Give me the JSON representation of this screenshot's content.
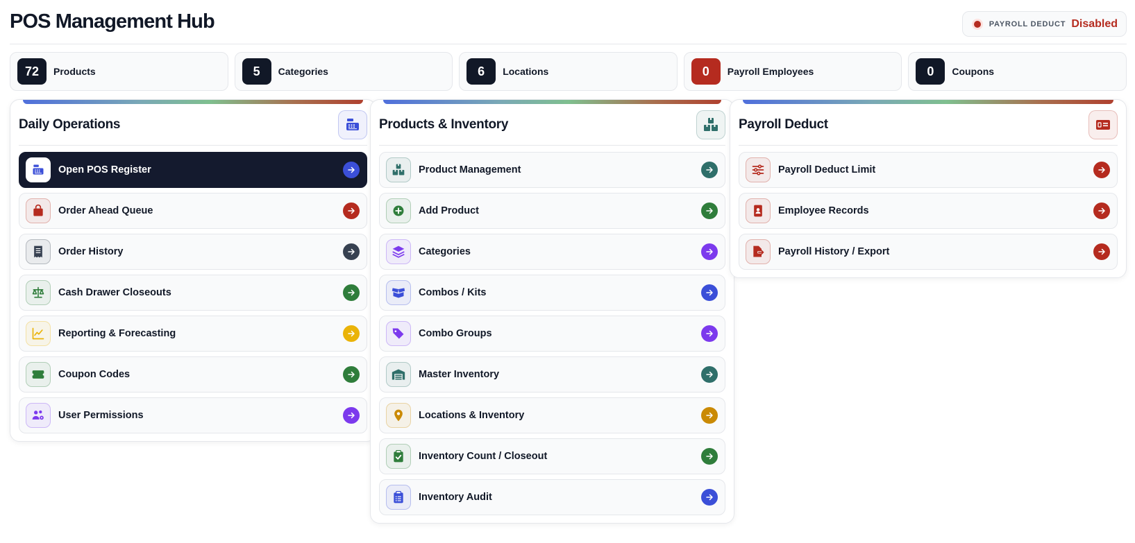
{
  "header": {
    "title": "POS Management Hub",
    "status_label": "PAYROLL DEDUCT",
    "status_value": "Disabled",
    "status_color": "#b52b1f"
  },
  "stats": [
    {
      "count": "72",
      "label": "Products",
      "color": "#111827"
    },
    {
      "count": "5",
      "label": "Categories",
      "color": "#111827"
    },
    {
      "count": "6",
      "label": "Locations",
      "color": "#111827"
    },
    {
      "count": "0",
      "label": "Payroll Employees",
      "color": "#b52b1f"
    },
    {
      "count": "0",
      "label": "Coupons",
      "color": "#111827"
    }
  ],
  "panels": [
    {
      "title": "Daily Operations",
      "icon": "cash-register-icon",
      "items": [
        {
          "label": "Open POS Register",
          "icon": "cash-register-icon",
          "color": "#3b4fd8",
          "active": true
        },
        {
          "label": "Order Ahead Queue",
          "icon": "shopping-bag-icon",
          "color": "#b52b1f"
        },
        {
          "label": "Order History",
          "icon": "receipt-icon",
          "color": "#374151"
        },
        {
          "label": "Cash Drawer Closeouts",
          "icon": "scale-icon",
          "color": "#2f7d3b"
        },
        {
          "label": "Reporting & Forecasting",
          "icon": "chart-line-icon",
          "color": "#eab308"
        },
        {
          "label": "Coupon Codes",
          "icon": "ticket-icon",
          "color": "#2f7d3b"
        },
        {
          "label": "User Permissions",
          "icon": "users-gear-icon",
          "color": "#7c3aed"
        }
      ]
    },
    {
      "title": "Products & Inventory",
      "icon": "boxes-icon",
      "items": [
        {
          "label": "Product Management",
          "icon": "boxes-icon",
          "color": "#2f6f6a"
        },
        {
          "label": "Add Product",
          "icon": "plus-circle-icon",
          "color": "#2f7d3b"
        },
        {
          "label": "Categories",
          "icon": "layers-icon",
          "color": "#7c3aed"
        },
        {
          "label": "Combos / Kits",
          "icon": "box-open-icon",
          "color": "#3b4fd8"
        },
        {
          "label": "Combo Groups",
          "icon": "tags-icon",
          "color": "#7c3aed"
        },
        {
          "label": "Master Inventory",
          "icon": "warehouse-icon",
          "color": "#2f6f6a"
        },
        {
          "label": "Locations & Inventory",
          "icon": "location-pin-icon",
          "color": "#ca8a04"
        },
        {
          "label": "Inventory Count / Closeout",
          "icon": "clipboard-check-icon",
          "color": "#2f7d3b"
        },
        {
          "label": "Inventory Audit",
          "icon": "clipboard-list-icon",
          "color": "#3b4fd8"
        }
      ]
    },
    {
      "title": "Payroll Deduct",
      "icon": "money-check-icon",
      "items": [
        {
          "label": "Payroll Deduct Limit",
          "icon": "sliders-icon",
          "color": "#b52b1f"
        },
        {
          "label": "Employee Records",
          "icon": "id-badge-icon",
          "color": "#b52b1f"
        },
        {
          "label": "Payroll History / Export",
          "icon": "file-export-icon",
          "color": "#b52b1f"
        }
      ]
    }
  ]
}
